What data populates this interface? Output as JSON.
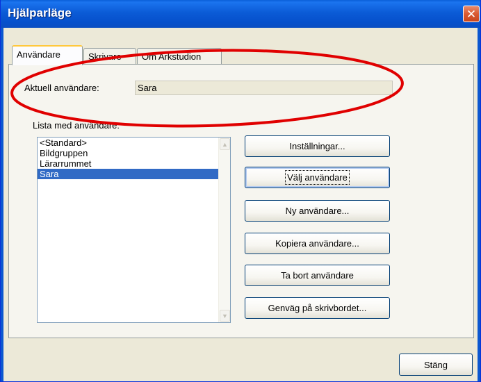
{
  "window": {
    "title": "Hjälparläge",
    "close_glyph": "✕"
  },
  "tabs": [
    {
      "label": "Användare",
      "active": true
    },
    {
      "label": "Skrivare",
      "active": false
    },
    {
      "label": "Om Arkstudion",
      "active": false
    }
  ],
  "current_user": {
    "label": "Aktuell användare:",
    "value": "Sara"
  },
  "user_list": {
    "label": "Lista med användare:",
    "items": [
      "<Standard>",
      "Bildgruppen",
      "Lärarrummet",
      "Sara"
    ],
    "selected": "Sara"
  },
  "buttons": {
    "settings": "Inställningar...",
    "select_user": "Välj användare",
    "new_user": "Ny användare...",
    "copy_user": "Kopiera användare...",
    "delete_user": "Ta bort användare",
    "desktop_shortcut": "Genväg på skrivbordet..."
  },
  "footer": {
    "close": "Stäng"
  },
  "colors": {
    "titlebar": "#0b5bd6",
    "selection": "#316ac5",
    "annotation": "#e00000"
  }
}
